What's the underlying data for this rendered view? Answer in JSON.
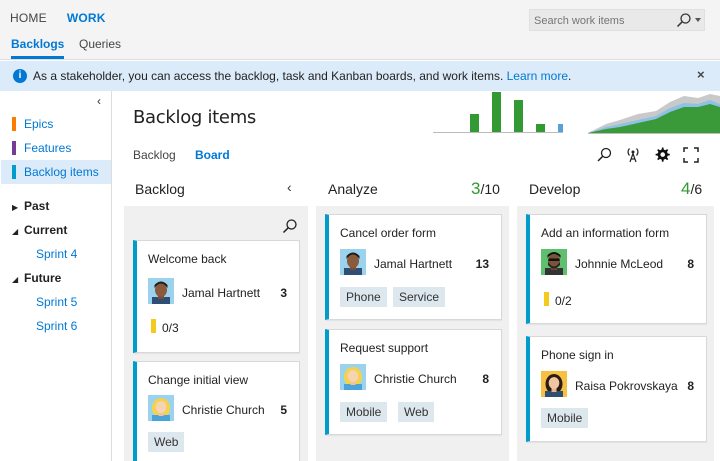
{
  "topnav": {
    "home": "HOME",
    "work": "WORK"
  },
  "search": {
    "placeholder": "Search work items"
  },
  "subnav": {
    "backlogs": "Backlogs",
    "queries": "Queries"
  },
  "infobar": {
    "message": "As a stakeholder, you can access the backlog, task and Kanban boards, and work items.",
    "link": "Learn more",
    "period": ".",
    "close": "×"
  },
  "sidebar": {
    "collapse": "‹",
    "items": [
      {
        "label": "Epics",
        "color": "#ff7b00"
      },
      {
        "label": "Features",
        "color": "#773b93"
      },
      {
        "label": "Backlog items",
        "color": "#009ccc"
      }
    ],
    "groups": [
      {
        "label": "Past",
        "arrow": "▶"
      },
      {
        "label": "Current",
        "arrow": "◢"
      },
      {
        "label": "Future",
        "arrow": "◢"
      }
    ],
    "sprints": [
      "Sprint 4",
      "Sprint 5",
      "Sprint 6"
    ]
  },
  "main": {
    "title": "Backlog items",
    "tabs": [
      "Backlog",
      "Board"
    ]
  },
  "velocity_chart": {
    "values": [
      0.45,
      1.0,
      0.8,
      0.2,
      0.2
    ],
    "colors": [
      "#339933",
      "#339933",
      "#339933",
      "#339933",
      "#5aa0d8"
    ]
  },
  "colors": {
    "accent": "#0078d4",
    "card_bar": "#009ccc",
    "count_ok": "#339933",
    "task": "#f2cb1d"
  },
  "board": {
    "columns": [
      {
        "title": "Backlog",
        "chevron": "‹",
        "cards": [
          {
            "title": "Welcome back",
            "assignee": "Jamal Hartnett",
            "effort": "3",
            "tags": [],
            "tasks": "0/3",
            "avatar": "man-dark"
          },
          {
            "title": "Change initial view",
            "assignee": "Christie Church",
            "effort": "5",
            "tags": [
              "Web"
            ],
            "tasks": "",
            "avatar": "woman-blonde"
          }
        ]
      },
      {
        "title": "Analyze",
        "count": "3",
        "limit": "/10",
        "cards": [
          {
            "title": "Cancel order form",
            "assignee": "Jamal Hartnett",
            "effort": "13",
            "tags": [
              "Phone",
              "Service"
            ],
            "tasks": "",
            "avatar": "man-dark"
          },
          {
            "title": "Request support",
            "assignee": "Christie Church",
            "effort": "8",
            "tags": [
              "Mobile",
              "Web"
            ],
            "tasks": "",
            "avatar": "woman-blonde"
          }
        ]
      },
      {
        "title": "Develop",
        "count": "4",
        "limit": "/6",
        "cards": [
          {
            "title": "Add an information form",
            "assignee": "Johnnie McLeod",
            "effort": "8",
            "tags": [],
            "tasks": "0/2",
            "avatar": "man-beard"
          },
          {
            "title": "Phone sign in",
            "assignee": "Raisa Pokrovskaya",
            "effort": "8",
            "tags": [
              "Mobile"
            ],
            "tasks": "",
            "avatar": "woman-dark"
          }
        ]
      }
    ]
  }
}
